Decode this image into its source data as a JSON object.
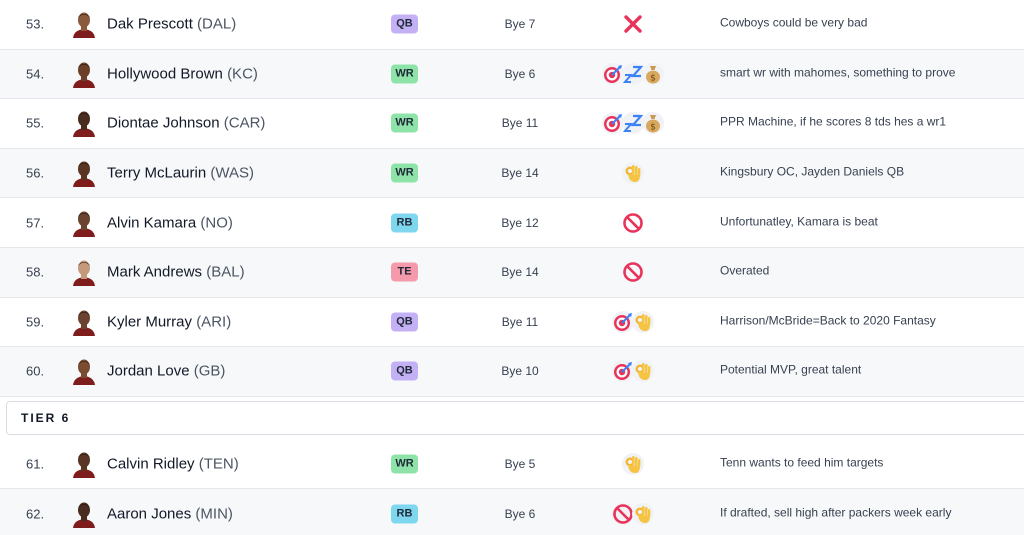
{
  "rows_before_tier": [
    {
      "rank": "53.",
      "name": "Dak Prescott",
      "team": "(DAL)",
      "pos": "QB",
      "bye": "Bye 7",
      "icons": [
        "cross-icon"
      ],
      "note": "Cowboys could be very bad",
      "skin": "#8a5a3a"
    },
    {
      "rank": "54.",
      "name": "Hollywood Brown",
      "team": "(KC)",
      "pos": "WR",
      "bye": "Bye 6",
      "icons": [
        "target-icon",
        "sleep-icon",
        "money-bag-icon"
      ],
      "note": "smart wr with mahomes, something to prove",
      "skin": "#6b3f28"
    },
    {
      "rank": "55.",
      "name": "Diontae Johnson",
      "team": "(CAR)",
      "pos": "WR",
      "bye": "Bye 11",
      "icons": [
        "target-icon",
        "sleep-icon",
        "money-bag-icon"
      ],
      "note": "PPR Machine, if he scores 8 tds hes a wr1",
      "skin": "#4a2c1e"
    },
    {
      "rank": "56.",
      "name": "Terry McLaurin",
      "team": "(WAS)",
      "pos": "WR",
      "bye": "Bye 14",
      "icons": [
        "ok-hand-icon"
      ],
      "note": "Kingsbury OC, Jayden Daniels QB",
      "skin": "#5a3524"
    },
    {
      "rank": "57.",
      "name": "Alvin Kamara",
      "team": "(NO)",
      "pos": "RB",
      "bye": "Bye 12",
      "icons": [
        "prohibited-icon"
      ],
      "note": "Unfortunatley, Kamara is beat",
      "skin": "#6a4430"
    },
    {
      "rank": "58.",
      "name": "Mark Andrews",
      "team": "(BAL)",
      "pos": "TE",
      "bye": "Bye 14",
      "icons": [
        "prohibited-icon"
      ],
      "note": "Overated",
      "skin": "#c49a7a"
    },
    {
      "rank": "59.",
      "name": "Kyler Murray",
      "team": "(ARI)",
      "pos": "QB",
      "bye": "Bye 11",
      "icons": [
        "target-icon",
        "ok-hand-icon"
      ],
      "note": "Harrison/McBride=Back to 2020 Fantasy",
      "skin": "#6b4230"
    },
    {
      "rank": "60.",
      "name": "Jordan Love",
      "team": "(GB)",
      "pos": "QB",
      "bye": "Bye 10",
      "icons": [
        "target-icon",
        "ok-hand-icon"
      ],
      "note": "Potential MVP, great talent",
      "skin": "#7a4c32"
    }
  ],
  "tier": {
    "label": "TIER 6"
  },
  "rows_after_tier": [
    {
      "rank": "61.",
      "name": "Calvin Ridley",
      "team": "(TEN)",
      "pos": "WR",
      "bye": "Bye 5",
      "icons": [
        "ok-hand-icon"
      ],
      "note": "Tenn wants to feed him targets",
      "skin": "#5a3524"
    },
    {
      "rank": "62.",
      "name": "Aaron Jones",
      "team": "(MIN)",
      "pos": "RB",
      "bye": "Bye 6",
      "icons": [
        "prohibited-icon",
        "ok-hand-icon"
      ],
      "note": "If drafted, sell high after packers week early",
      "skin": "#4a2c1e"
    }
  ]
}
